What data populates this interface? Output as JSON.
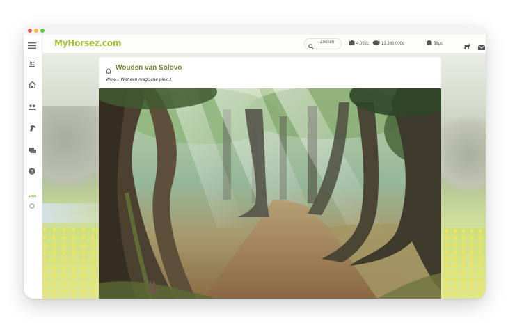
{
  "app": {
    "logo_text": "MyHorsez",
    "logo_domain": ".com"
  },
  "search": {
    "label": "Zoeken"
  },
  "stats": {
    "coins": "4.092c",
    "money": "13.380.000c",
    "points": "58pc"
  },
  "sidebar": {
    "badge": "▲158"
  },
  "location": {
    "title": "Wouden van Solovo",
    "subtitle": "Wow... Wat een magische plek..!"
  },
  "colors": {
    "accent": "#9bbf34",
    "title": "#7a7f2c"
  },
  "icons": [
    "menu-icon",
    "news-icon",
    "stable-icon",
    "community-icon",
    "horse-icon",
    "chat-icon",
    "help-icon",
    "circle-icon",
    "search-icon",
    "coins-icon",
    "money-icon",
    "points-icon",
    "horse-silhouette-icon",
    "mail-icon",
    "bell-icon"
  ]
}
